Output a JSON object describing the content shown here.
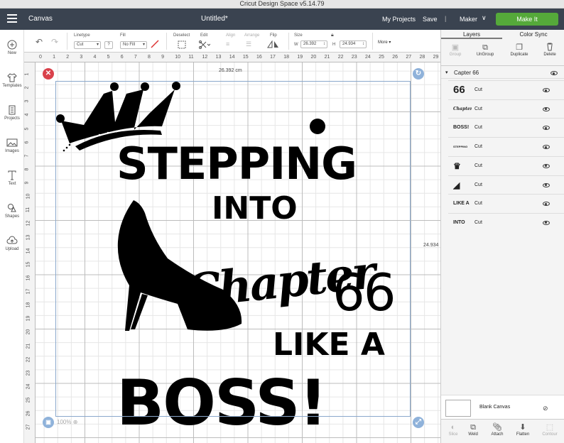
{
  "window": {
    "title": "Cricut Design Space  v5.14.79"
  },
  "topbar": {
    "section": "Canvas",
    "doc_title": "Untitled*",
    "my_projects": "My Projects",
    "save": "Save",
    "separator": "|",
    "machine": "Maker",
    "make_it": "Make It"
  },
  "sidebar": {
    "items": [
      {
        "label": "New",
        "icon": "plus-icon"
      },
      {
        "label": "Templates",
        "icon": "shirt-icon"
      },
      {
        "label": "Projects",
        "icon": "projects-icon"
      },
      {
        "label": "Images",
        "icon": "images-icon"
      },
      {
        "label": "Text",
        "icon": "text-icon"
      },
      {
        "label": "Shapes",
        "icon": "shapes-icon"
      },
      {
        "label": "Upload",
        "icon": "upload-icon"
      }
    ]
  },
  "toolbar": {
    "linetype_label": "Linetype",
    "linetype_value": "Cut",
    "fill_label": "Fill",
    "fill_value": "No Fill",
    "question": "?",
    "deselect": "Deselect",
    "edit": "Edit",
    "align": "Align",
    "arrange": "Arrange",
    "flip": "Flip",
    "size_label": "Size",
    "w_label": "W",
    "w_value": "26.392",
    "h_label": "H",
    "h_value": "24.934",
    "more": "More"
  },
  "panel": {
    "tabs": [
      "Layers",
      "Color Sync"
    ],
    "tools": [
      {
        "label": "Group",
        "icon": "group-icon",
        "enabled": false
      },
      {
        "label": "UnGroup",
        "icon": "ungroup-icon",
        "enabled": true
      },
      {
        "label": "Duplicate",
        "icon": "duplicate-icon",
        "enabled": true
      },
      {
        "label": "Delete",
        "icon": "trash-icon",
        "enabled": true
      }
    ],
    "group_name": "Capter 66",
    "layers": [
      {
        "thumb": "66",
        "label": "Cut"
      },
      {
        "thumb": "Chapter",
        "label": "Cut"
      },
      {
        "thumb": "BOSS!",
        "label": "Cut"
      },
      {
        "thumb": "STEPPING",
        "label": "Cut"
      },
      {
        "thumb": "crown",
        "label": "Cut"
      },
      {
        "thumb": "heel",
        "label": "Cut"
      },
      {
        "thumb": "LIKE A",
        "label": "Cut"
      },
      {
        "thumb": "INTO",
        "label": "Cut"
      }
    ],
    "blank_canvas": "Blank Canvas",
    "bottom_tools": [
      {
        "label": "Slice",
        "icon": "slice-icon",
        "enabled": false
      },
      {
        "label": "Weld",
        "icon": "weld-icon",
        "enabled": true
      },
      {
        "label": "Attach",
        "icon": "attach-icon",
        "enabled": true
      },
      {
        "label": "Flatten",
        "icon": "flatten-icon",
        "enabled": true
      },
      {
        "label": "Contour",
        "icon": "contour-icon",
        "enabled": false
      }
    ]
  },
  "canvas": {
    "ruler_top": [
      "0",
      "1",
      "2",
      "3",
      "4",
      "5",
      "6",
      "7",
      "8",
      "9",
      "10",
      "11",
      "12",
      "13",
      "14",
      "15",
      "16",
      "17",
      "18",
      "19",
      "20",
      "21",
      "22",
      "23",
      "24",
      "25",
      "26",
      "27",
      "28",
      "29"
    ],
    "ruler_left": [
      "1",
      "2",
      "3",
      "4",
      "5",
      "6",
      "7",
      "8",
      "9",
      "10",
      "11",
      "12",
      "13",
      "14",
      "15",
      "16",
      "17",
      "18",
      "19",
      "20",
      "21",
      "22",
      "23",
      "24",
      "25",
      "26",
      "27"
    ],
    "width_readout": "26.392 cm",
    "height_readout": "24.934",
    "zoom": "100%",
    "design": {
      "line1": "STEPPING",
      "line2": "INTO",
      "line3_script": "Chapter",
      "line3_num": "66",
      "line4": "LIKE A",
      "line5": "BOSS!"
    }
  },
  "colors": {
    "topbar": "#3a4350",
    "make_it": "#55a93a",
    "delete_handle": "#d9414b",
    "rotate_handle": "#8fb2da"
  }
}
